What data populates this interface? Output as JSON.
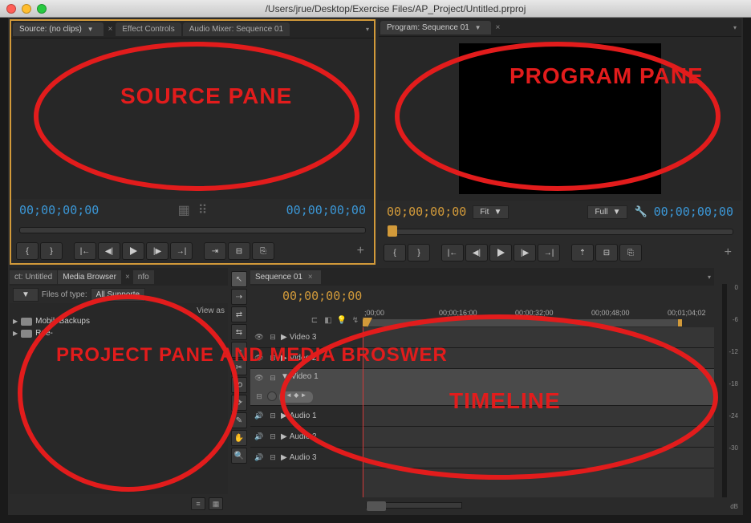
{
  "window": {
    "title": "/Users/jrue/Desktop/Exercise Files/AP_Project/Untitled.prproj"
  },
  "source": {
    "tab_label": "Source: (no clips)",
    "effect_controls": "Effect Controls",
    "audio_mixer": "Audio Mixer: Sequence 01",
    "in_tc": "00;00;00;00",
    "out_tc": "00;00;00;00"
  },
  "program": {
    "tab_label": "Program: Sequence 01",
    "play_tc": "00;00;00;00",
    "dur_tc": "00;00;00;00",
    "fit_label": "Fit",
    "full_label": "Full"
  },
  "project": {
    "tabs": [
      "ct: Untitled",
      "Media Browser",
      "nfo"
    ],
    "files_of_type_label": "Files of type:",
    "filter_value": "All Supporte",
    "view_as": "View as",
    "items": [
      "MobileBackups",
      "Rue-"
    ]
  },
  "timeline": {
    "tab": "Sequence 01",
    "play_tc": "00;00;00;00",
    "ruler": [
      ";00;00",
      "00;00;16;00",
      "00;00;32;00",
      "00;00;48;00",
      "00;01;04;02"
    ],
    "video_tracks": [
      "Video 3",
      "Video 2",
      "Video 1"
    ],
    "audio_tracks": [
      "Audio 1",
      "Audio 2",
      "Audio 3"
    ]
  },
  "meters": {
    "scale": [
      "0",
      "-6",
      "-12",
      "-18",
      "-24",
      "-30",
      ""
    ],
    "unit": "dB"
  },
  "annotations": {
    "source": "SOURCE PANE",
    "program": "PROGRAM PANE",
    "project": "PROJECT PANE AND MEDIA BROSWER",
    "timeline": "TIMELINE"
  }
}
